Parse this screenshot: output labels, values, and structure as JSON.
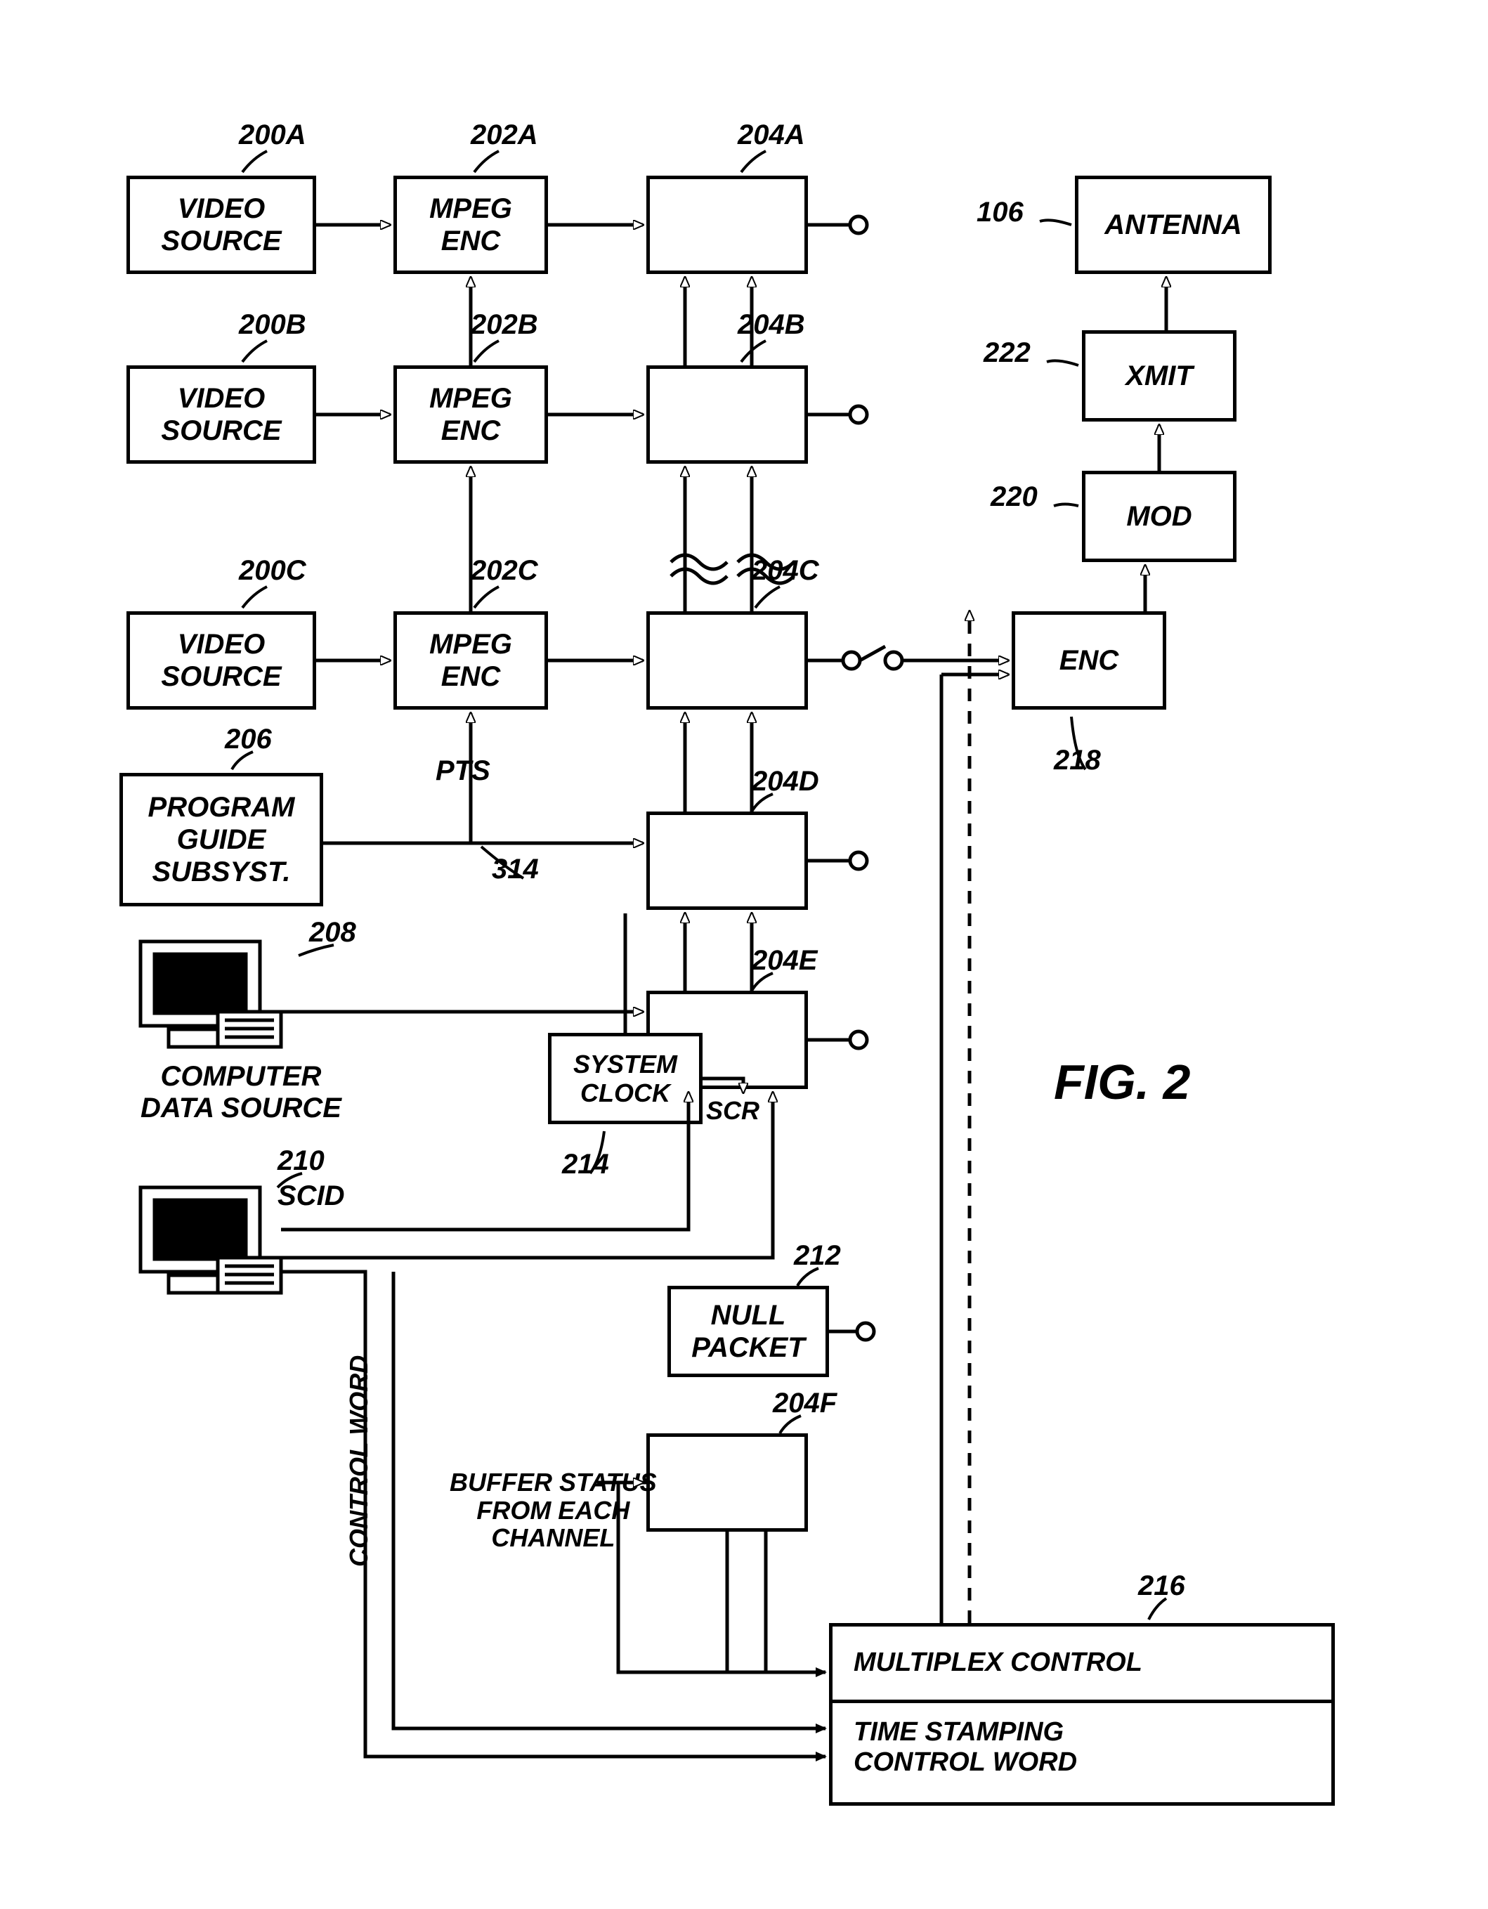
{
  "figure_label": "FIG. 2",
  "boxes": {
    "video_source_a": "VIDEO\nSOURCE",
    "video_source_b": "VIDEO\nSOURCE",
    "video_source_c": "VIDEO\nSOURCE",
    "mpeg_enc_a": "MPEG\nENC",
    "mpeg_enc_b": "MPEG\nENC",
    "mpeg_enc_c": "MPEG\nENC",
    "program_guide": "PROGRAM\nGUIDE\nSUBSYST.",
    "computer_data_source": "COMPUTER\nDATA SOURCE",
    "system_clock": "SYSTEM\nCLOCK",
    "null_packet": "NULL\nPACKET",
    "enc": "ENC",
    "mod": "MOD",
    "xmit": "XMIT",
    "antenna": "ANTENNA",
    "multiplex_control_line1": "MULTIPLEX CONTROL",
    "multiplex_control_line2": "TIME STAMPING\nCONTROL WORD"
  },
  "refs": {
    "r200A": "200A",
    "r200B": "200B",
    "r200C": "200C",
    "r202A": "202A",
    "r202B": "202B",
    "r202C": "202C",
    "r204A": "204A",
    "r204B": "204B",
    "r204C": "204C",
    "r204D": "204D",
    "r204E": "204E",
    "r204F": "204F",
    "r206": "206",
    "r208": "208",
    "r210": "210",
    "r212": "212",
    "r214": "214",
    "r216": "216",
    "r218": "218",
    "r220": "220",
    "r222": "222",
    "r106": "106",
    "r314": "314"
  },
  "signals": {
    "pts": "PTS",
    "scr": "SCR",
    "scid": "SCID",
    "control_word": "CONTROL WORD",
    "buffer_status": "BUFFER STATUS\nFROM EACH\nCHANNEL"
  }
}
